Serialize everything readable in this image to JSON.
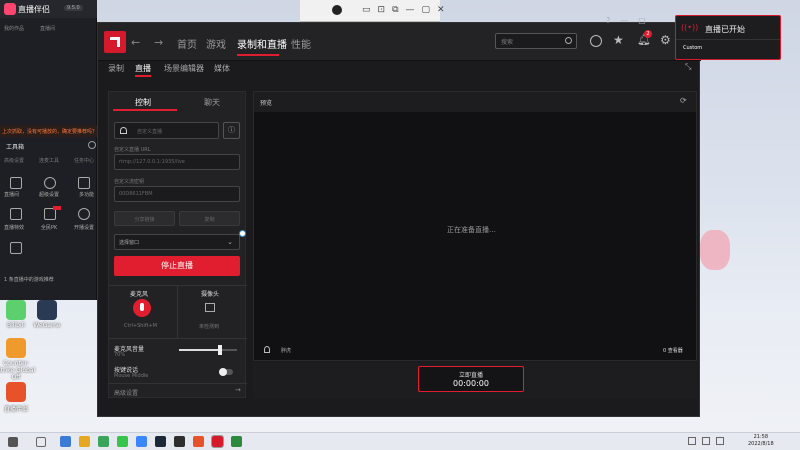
{
  "mini_window": {
    "controls": [
      "▭",
      "⊡",
      "⧉",
      "—",
      "▢",
      "✕"
    ]
  },
  "left_app": {
    "title": "直播伴侣",
    "version_badge": "9.5.0",
    "top_tabs": [
      "我的作品",
      "直播间"
    ],
    "notice": "上次抓取，没有可播放的，确定要推荐吗？",
    "tool_header": "工具箱",
    "tools_row1": [
      "高级设置",
      "连麦工具",
      "任务中心"
    ],
    "tools_row2": [
      "直播间",
      "超级设置",
      "多功能"
    ],
    "tools_row3": [
      "直播特效",
      "全民PK",
      "开播设置"
    ],
    "footer": "1 条直播中的游戏推荐"
  },
  "desktop_icons": [
    {
      "label": "Bilibili",
      "color": "#5bd06c"
    },
    {
      "label": "WeGame",
      "color": "#2a3a55"
    },
    {
      "label": "Counter-Strike Global Off",
      "color": "#f09a2d"
    },
    {
      "label": "直播伴侣",
      "color": "#e8522a"
    }
  ],
  "amd": {
    "nav": {
      "home": "首页",
      "games": "游戏",
      "record": "录制和直播",
      "performance": "性能"
    },
    "search_placeholder": "搜索",
    "notif_badge": "2",
    "subnav": [
      "录制",
      "直播",
      "场景编辑器",
      "媒体"
    ],
    "control": {
      "tabs": [
        "控制",
        "聊天"
      ],
      "platform_placeholder": "自定义直播",
      "url_label": "自定义直播 URL",
      "url_value": "rtmp://127.0.0.1:1935/live",
      "key_label": "自定义流密钥",
      "key_value": "00D8611FBM",
      "copy_btn": "分享链接",
      "btn2": "复制",
      "select_label": "选择窗口",
      "stop_button": "停止直播",
      "mic_label": "麦克风",
      "mic_shortcut": "Ctrl+Shift+M",
      "camera_label": "摄像头",
      "camera_status": "未检测到",
      "mic_volume_label": "麦克风音量",
      "mic_volume_value": "70%",
      "mic_volume_level": 0.7,
      "ptt_label": "按键说话",
      "ptt_sub": "Mouse Middle",
      "advanced": "高级设置"
    },
    "preview": {
      "title": "预览",
      "status": "正在准备直播…",
      "user": "胖虎",
      "viewers": "0 查看器"
    },
    "live": {
      "label": "立即直播",
      "timer": "00:00:00"
    }
  },
  "notification": {
    "title": "直播已开始",
    "item": "Custom"
  },
  "taskbar": {
    "time": "21:58",
    "date": "2022/8/18"
  },
  "colors": {
    "accent": "#e01e30",
    "panel": "#222225",
    "bg": "#1b1b1d"
  }
}
